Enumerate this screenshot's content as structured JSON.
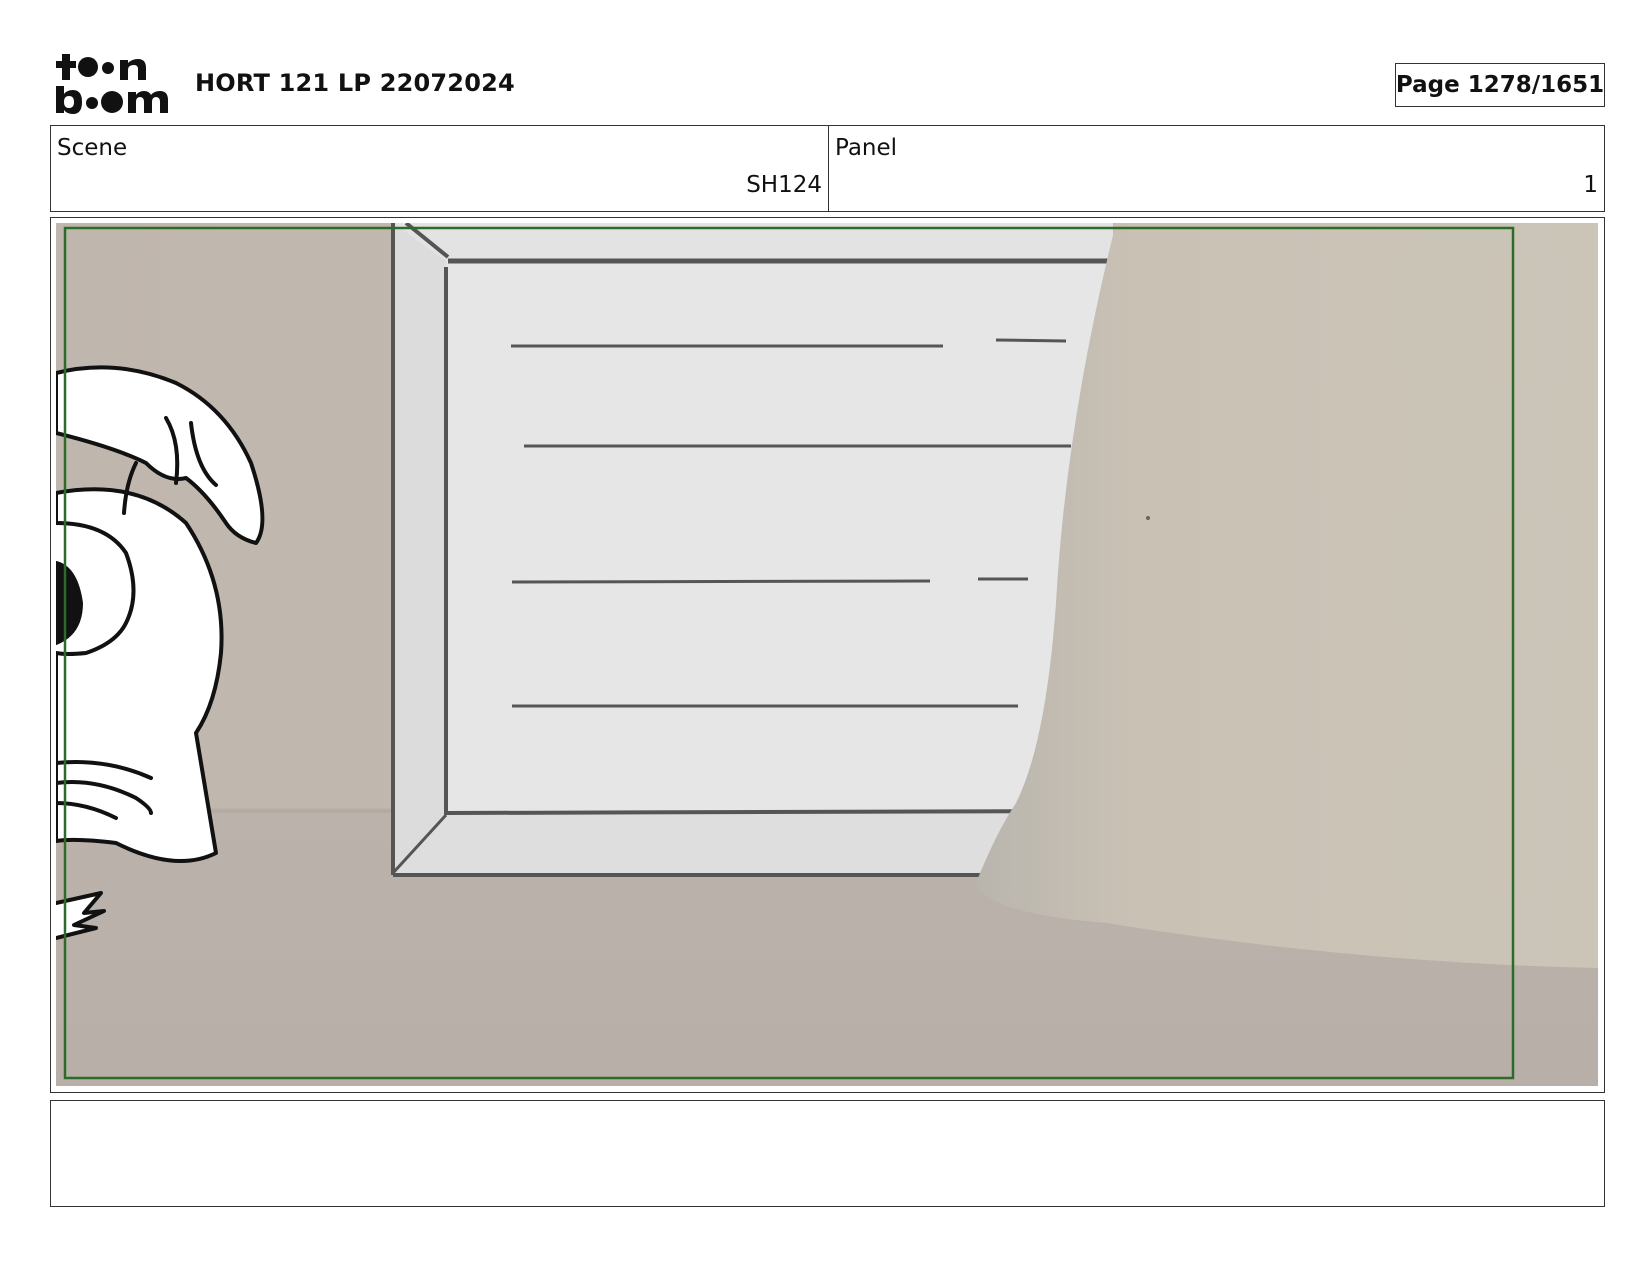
{
  "header": {
    "logo_icon": "toonboom-logo",
    "title": "HORT 121 LP 22072024",
    "page_label": "Page 1278/1651"
  },
  "info": {
    "scene_label": "Scene",
    "scene_value": "SH124",
    "panel_label": "Panel",
    "panel_value": "1"
  },
  "frame": {
    "safe_area_color": "#2e6b2a",
    "wall_color": "#c1b8ae",
    "floor_color": "#b9b1aa",
    "window_fill": "#e6e6e6",
    "line_color": "#555555"
  },
  "notes": {
    "text": ""
  }
}
